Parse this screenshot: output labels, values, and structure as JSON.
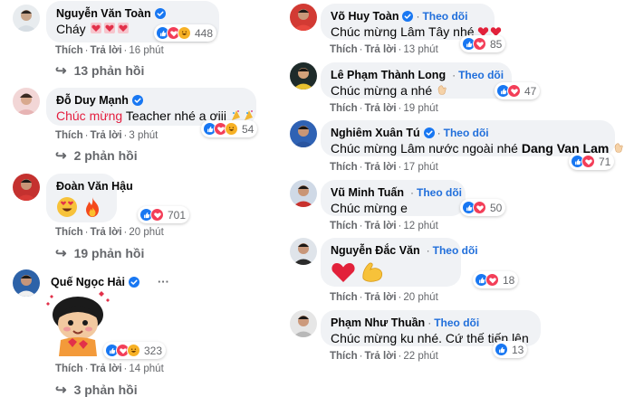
{
  "labels": {
    "like": "Thích",
    "reply": "Trả lời",
    "follow": "Theo dõi",
    "dot": "·"
  },
  "left": [
    {
      "name": "Nguyễn Văn Toàn",
      "text": "Cháy",
      "reactions": "448",
      "time": "16 phút",
      "replies": "13 phản hồi"
    },
    {
      "name": "Đỗ Duy Mạnh",
      "text_highlight": "Chúc mừng",
      "text": " Teacher nhé a ơiii",
      "reactions": "54",
      "time": "3 phút",
      "replies": "2 phản hồi"
    },
    {
      "name": "Đoàn Văn Hậu",
      "reactions": "701",
      "time": "20 phút",
      "replies": "19 phản hồi"
    },
    {
      "name": "Quế Ngọc Hải",
      "more": "···",
      "reactions": "323",
      "time": "14 phút",
      "replies": "3 phản hồi"
    }
  ],
  "right": [
    {
      "name": "Võ Huy Toàn",
      "text": "Chúc mừng Lâm Tây nhé",
      "reactions": "85",
      "time": "13 phút"
    },
    {
      "name": "Lê Phạm Thành Long",
      "text": "Chúc mừng a nhé",
      "reactions": "47",
      "time": "19 phút"
    },
    {
      "name": "Nghiêm Xuân Tú",
      "text": "Chúc mừng Lâm nước ngoài nhé ",
      "tag": "Dang Van Lam",
      "reactions": "71",
      "time": "17 phút"
    },
    {
      "name": "Vũ Minh Tuấn",
      "text": "Chúc mừng e",
      "reactions": "50",
      "time": "12 phút"
    },
    {
      "name": "Nguyễn Đắc Văn",
      "reactions": "18",
      "time": "20 phút"
    },
    {
      "name": "Phạm Như Thuần",
      "text": "Chúc mừng ku nhé. Cứ thế tiến lên",
      "reactions": "13",
      "time": "22 phút"
    }
  ]
}
